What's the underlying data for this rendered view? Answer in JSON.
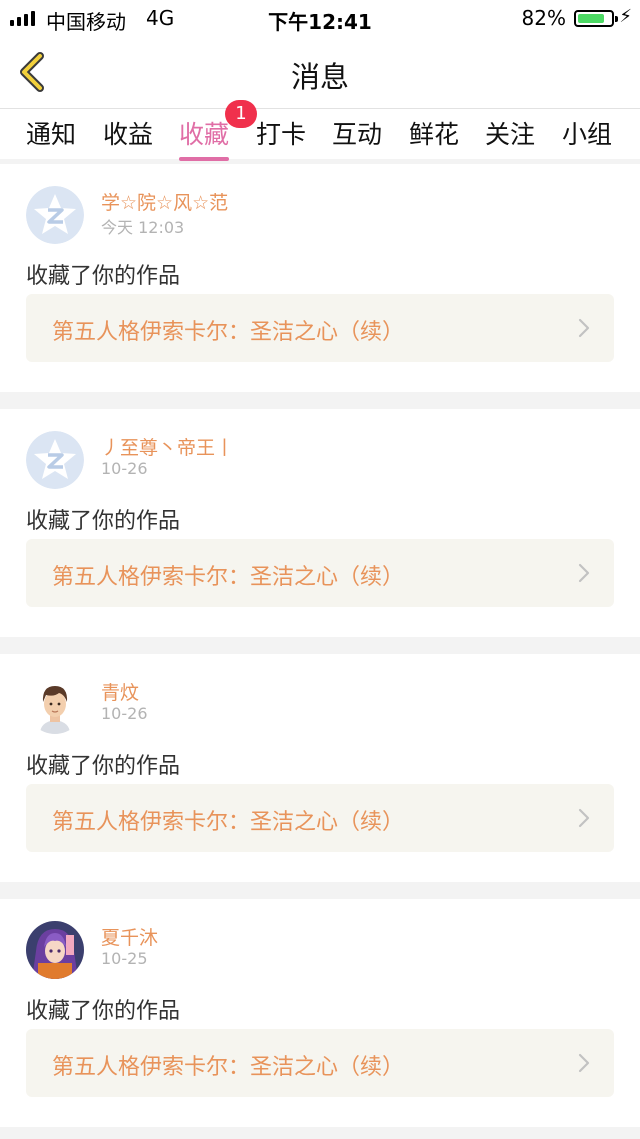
{
  "status_bar": {
    "carrier": "中国移动",
    "network": "4G",
    "time": "下午12:41",
    "battery": "82%",
    "battery_level": 0.82
  },
  "nav": {
    "title": "消息",
    "back_icon": "chevron-left-icon"
  },
  "tabs": {
    "items": [
      "通知",
      "收益",
      "收藏",
      "打卡",
      "互动",
      "鲜花",
      "关注",
      "小组"
    ],
    "active": "收藏",
    "badge": "1"
  },
  "messages": [
    {
      "user": "学☆院☆风☆范",
      "time": "今天 12:03",
      "action": "收藏了你的作品",
      "work": "第五人格伊索卡尔：圣洁之心（续）",
      "avatar": "default-qq-avatar-icon"
    },
    {
      "user": "丿至尊丶帝王丨",
      "time": "10-26",
      "action": "收藏了你的作品",
      "work": "第五人格伊索卡尔：圣洁之心（续）",
      "avatar": "default-qq-avatar-icon"
    },
    {
      "user": "青炆",
      "time": "10-26",
      "action": "收藏了你的作品",
      "work": "第五人格伊索卡尔：圣洁之心（续）",
      "avatar": "cartoon-boy-avatar"
    },
    {
      "user": "夏千沐",
      "time": "10-25",
      "action": "收藏了你的作品",
      "work": "第五人格伊索卡尔：圣洁之心（续）",
      "avatar": "anime-girl-avatar"
    }
  ],
  "colors": {
    "accent": "#e06ea6",
    "badge": "#f0304c",
    "username": "#e8935a",
    "work_bg": "#f6f5ef"
  }
}
